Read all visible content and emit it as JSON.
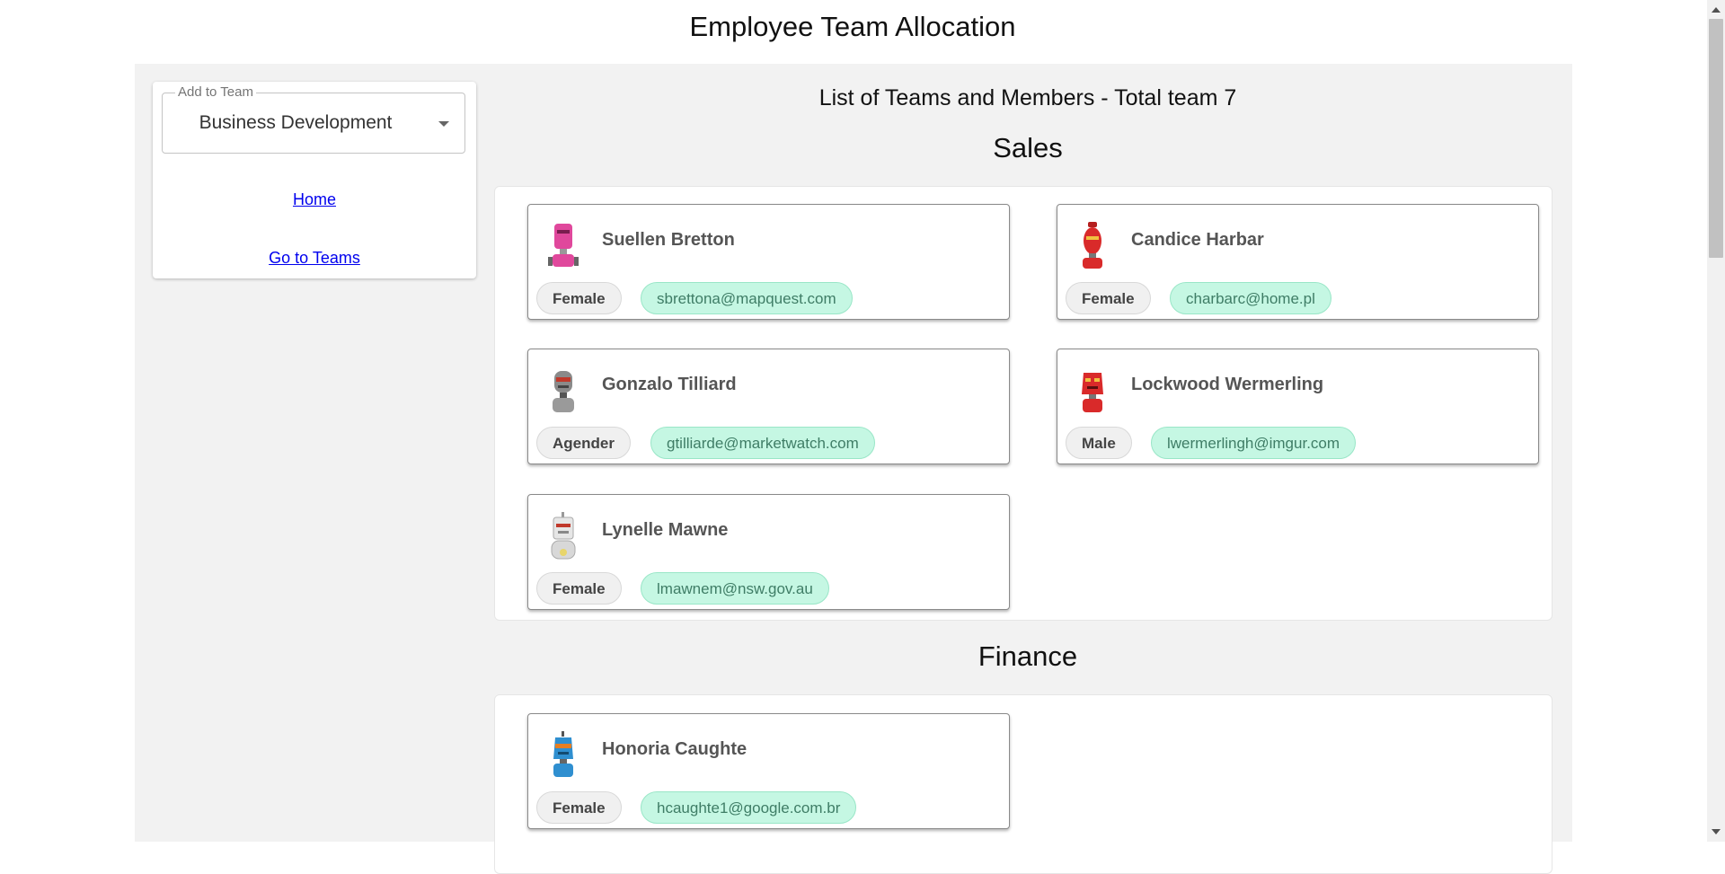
{
  "page": {
    "title": "Employee Team Allocation"
  },
  "sidebar": {
    "select": {
      "label": "Add to Team",
      "value": "Business Development"
    },
    "links": {
      "home": "Home",
      "teams": "Go to Teams"
    }
  },
  "content": {
    "list_title": "List of Teams and Members - Total team 7",
    "teams": [
      {
        "name": "Sales",
        "members": [
          {
            "name": "Suellen Bretton",
            "gender": "Female",
            "email": "sbrettona@mapquest.com",
            "avatar_color": "#e0489c"
          },
          {
            "name": "Candice Harbar",
            "gender": "Female",
            "email": "charbarc@home.pl",
            "avatar_color": "#d92a2a"
          },
          {
            "name": "Gonzalo Tilliard",
            "gender": "Agender",
            "email": "gtilliarde@marketwatch.com",
            "avatar_color": "#8a8a8a"
          },
          {
            "name": "Lockwood Wermerling",
            "gender": "Male",
            "email": "lwermerlingh@imgur.com",
            "avatar_color": "#d92a2a"
          },
          {
            "name": "Lynelle Mawne",
            "gender": "Female",
            "email": "lmawnem@nsw.gov.au",
            "avatar_color": "#d8d8d8"
          }
        ]
      },
      {
        "name": "Finance",
        "members": [
          {
            "name": "Honoria Caughte",
            "gender": "Female",
            "email": "hcaughte1@google.com.br",
            "avatar_color": "#2f8fd0"
          }
        ]
      }
    ]
  }
}
